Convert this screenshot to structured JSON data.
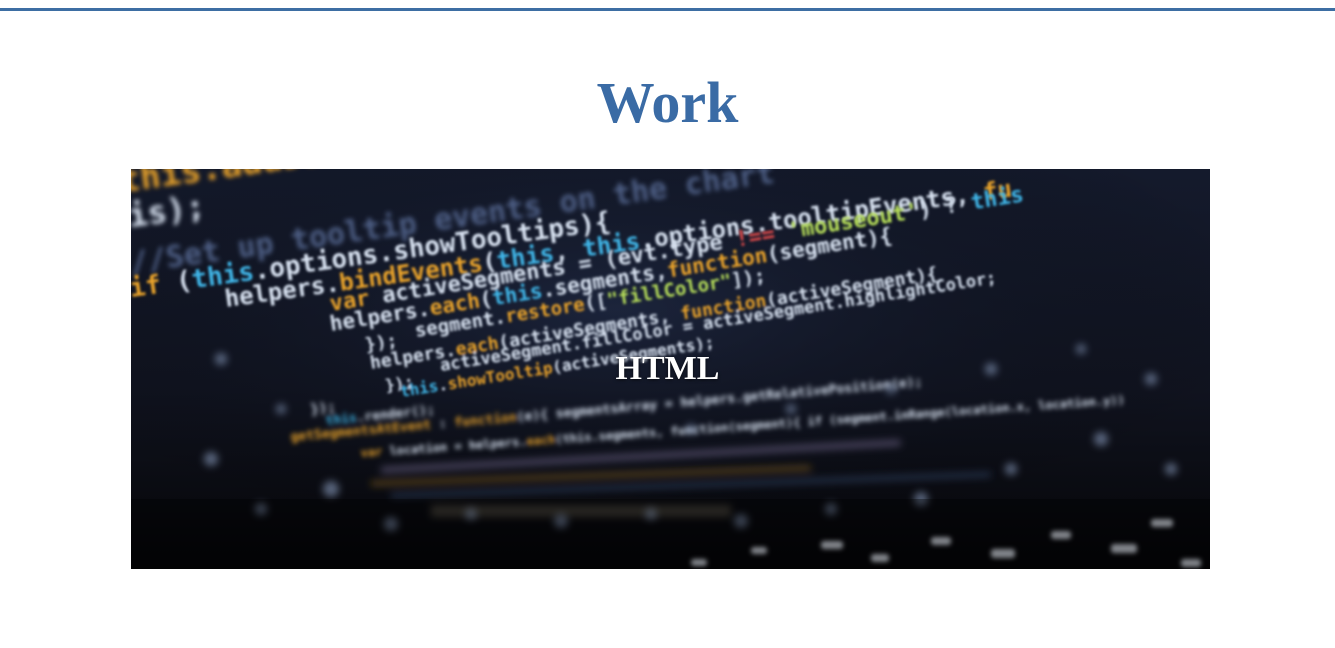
{
  "page": {
    "heading": "Work",
    "accent_color": "#3a6ba5"
  },
  "work_card": {
    "caption": "HTML",
    "image_description_icon": "code-screen-photo"
  }
}
